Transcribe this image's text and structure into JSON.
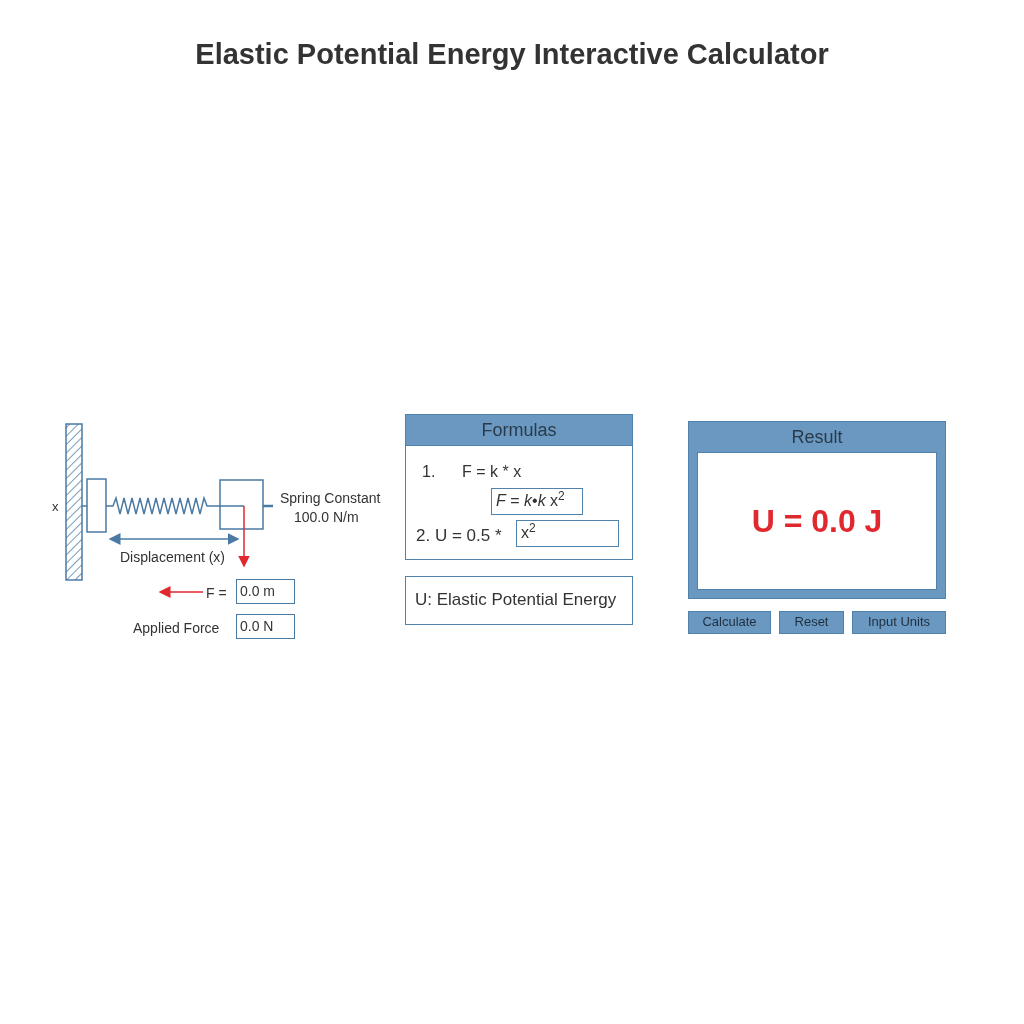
{
  "title": "Elastic Potential Energy Interactive Calculator",
  "diagram": {
    "wall_label": "x",
    "spring_constant_label": "Spring Constant",
    "spring_constant_value": "100.0 N/m",
    "displacement_label": "Displacement (x)",
    "force_label": "F =",
    "force_value": "0.0 m",
    "applied_force_label": "Applied Force",
    "applied_force_value": "0.0 N"
  },
  "formulas": {
    "title": "Formulas",
    "line_1_number": "1.",
    "line_1": "F = k * x",
    "line_1_field": "*F* = *k*•*k* x$^{2}$",
    "line_2": "2. U = 0.5 *",
    "line_2_field": "x$^{2}$"
  },
  "legend": "U: Elastic Potential Energy",
  "result": {
    "title": "Result",
    "value": "U = 0.0 J"
  },
  "buttons": [
    "Calculate",
    "Reset",
    "Input Units"
  ]
}
